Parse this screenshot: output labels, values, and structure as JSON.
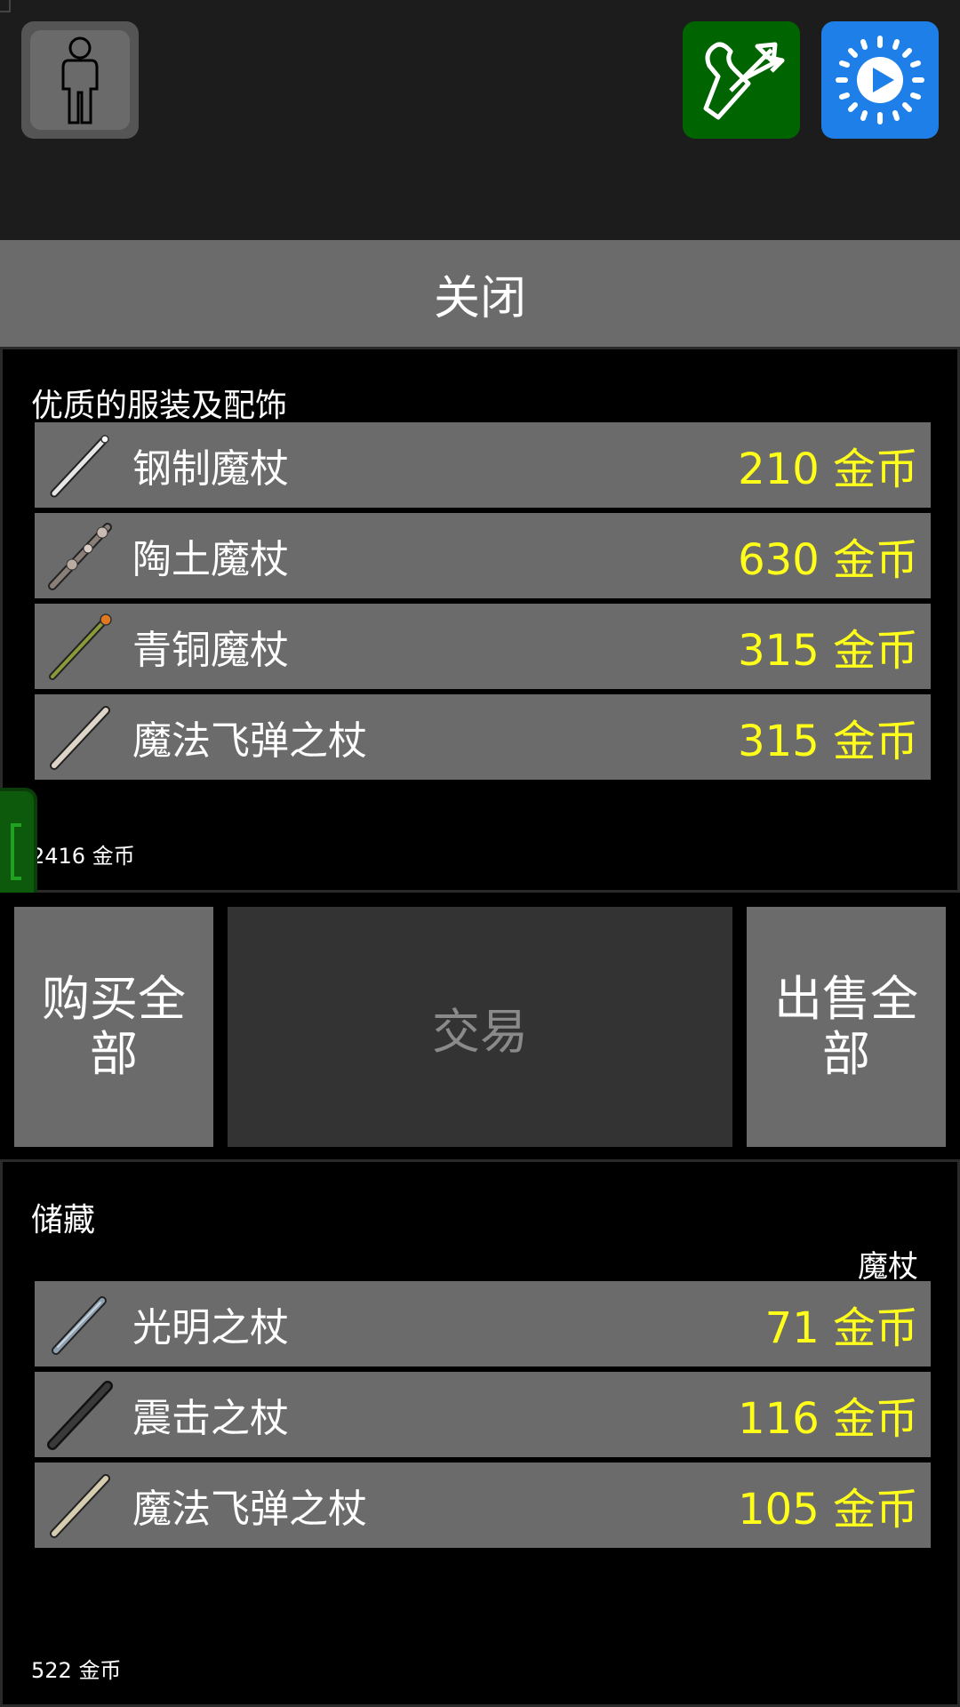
{
  "top_bar": {
    "character_icon": "person-silhouette-icon",
    "quiver_icon": "quiver-arrows-icon",
    "speed_icon": "play-speed-icon",
    "colors": {
      "quiver_bg": "#006400",
      "speed_bg": "#1e7fe8"
    }
  },
  "close_label": "关闭",
  "vendor": {
    "title": "优质的服装及配饰",
    "items": [
      {
        "name": "钢制魔杖",
        "price": "210 金币",
        "icon": "steel-wand-icon"
      },
      {
        "name": "陶土魔杖",
        "price": "630 金币",
        "icon": "clay-wand-icon"
      },
      {
        "name": "青铜魔杖",
        "price": "315 金币",
        "icon": "bronze-wand-icon"
      },
      {
        "name": "魔法飞弹之杖",
        "price": "315 金币",
        "icon": "magic-missile-wand-icon"
      }
    ],
    "gold": "2416 金币"
  },
  "trade": {
    "buy_all": "购买全部",
    "trade": "交易",
    "sell_all": "出售全部"
  },
  "stash": {
    "title": "储藏",
    "filter": "魔杖",
    "items": [
      {
        "name": "光明之杖",
        "price": "71 金币",
        "icon": "light-wand-icon"
      },
      {
        "name": "震击之杖",
        "price": "116 金币",
        "icon": "shock-wand-icon"
      },
      {
        "name": "魔法飞弹之杖",
        "price": "105 金币",
        "icon": "magic-missile-wand-icon"
      }
    ],
    "gold": "522 金币"
  },
  "colors": {
    "price": "#ffff1a",
    "row_bg": "#6b6b6b",
    "trade_disabled_bg": "#333333"
  }
}
